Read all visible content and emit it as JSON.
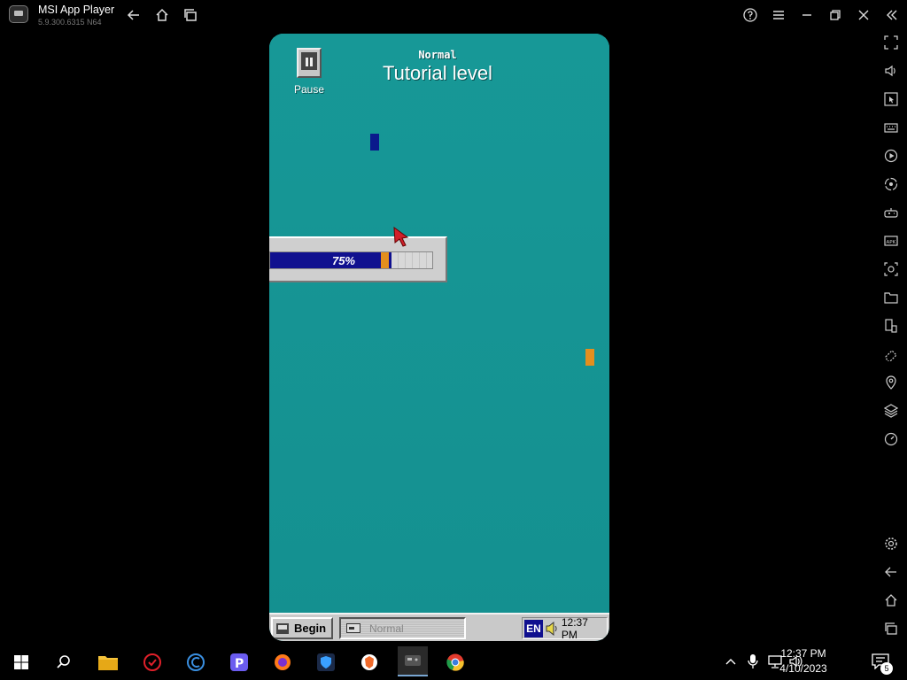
{
  "window": {
    "app_name": "MSI App Player",
    "version": "5.9.300.6315 N64"
  },
  "game": {
    "pause_label": "Pause",
    "mode": "Normal",
    "level_title": "Tutorial level",
    "progress_percent": 75,
    "progress_text": "75%",
    "colors": {
      "background": "#149493",
      "blue_block": "#0a1a8c",
      "orange_block": "#e48f1e",
      "progress_fill": "#10108f"
    }
  },
  "game_taskbar": {
    "begin_label": "Begin",
    "task_label": "Normal",
    "language": "EN",
    "clock": "12:37 PM"
  },
  "windows_taskbar": {
    "apps": [
      "start-icon",
      "search-icon",
      "file-explorer-icon",
      "antivirus-icon",
      "ccleaner-icon",
      "pdf-app-icon",
      "firefox-icon",
      "security-shield-icon",
      "brave-browser-icon",
      "msi-app-player-icon",
      "chrome-icon"
    ],
    "time": "12:37 PM",
    "date": "4/10/2023",
    "notification_count": "5"
  }
}
